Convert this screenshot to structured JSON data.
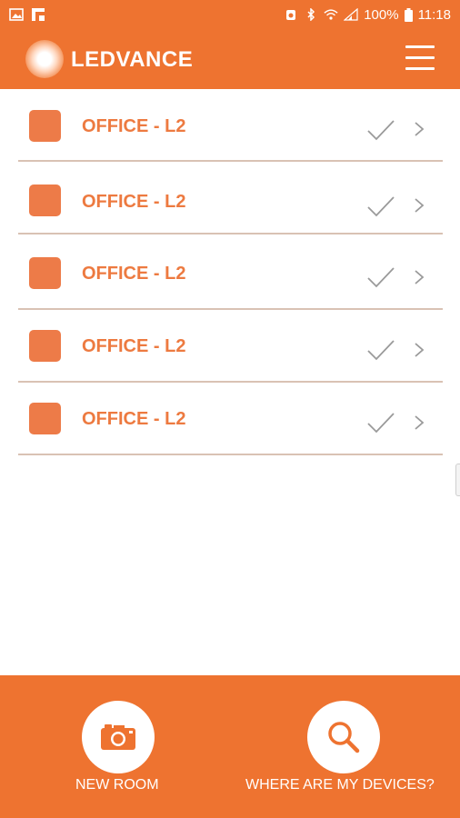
{
  "status_bar": {
    "battery": "100%",
    "time": "11:18",
    "icons": [
      "gallery-icon",
      "flipboard-icon",
      "alarm-icon",
      "bluetooth-icon",
      "wifi-icon",
      "signal-icon",
      "battery-icon"
    ]
  },
  "app_bar": {
    "brand": "LEDVANCE",
    "logo_icon": "ledvance-logo-icon",
    "menu_icon": "hamburger-menu-icon"
  },
  "rooms": [
    {
      "name": "OFFICE - L2",
      "status_icon": "check-icon"
    },
    {
      "name": "OFFICE - L2",
      "status_icon": "check-icon"
    },
    {
      "name": "OFFICE - L2",
      "status_icon": "check-icon"
    },
    {
      "name": "OFFICE - L2",
      "status_icon": "check-icon"
    },
    {
      "name": "OFFICE - L2",
      "status_icon": "check-icon"
    }
  ],
  "bottom_actions": {
    "new_room": {
      "label": "NEW ROOM",
      "icon": "camera-icon"
    },
    "find_devices": {
      "label": "WHERE ARE MY DEVICES?",
      "icon": "search-icon"
    }
  },
  "colors": {
    "primary": "#ee7330",
    "room_swatch": "#ed7b48",
    "room_text": "#ed7a40",
    "divider": "#d9c2b4"
  }
}
